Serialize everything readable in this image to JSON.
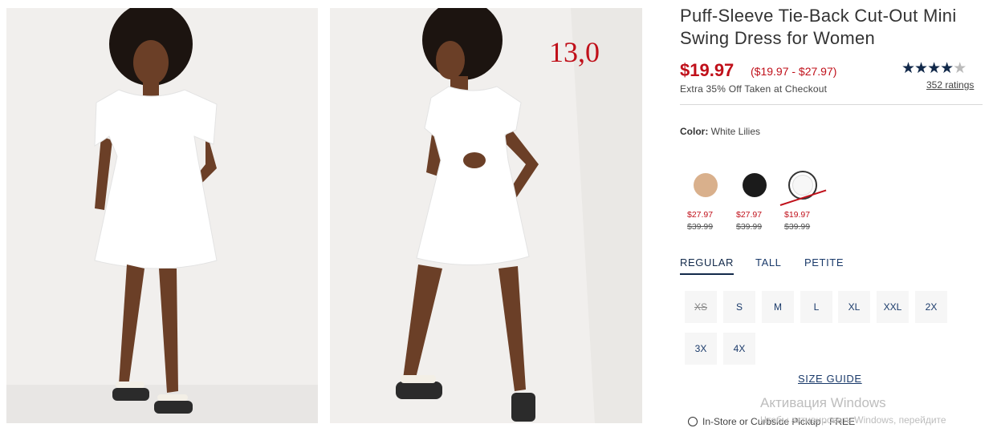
{
  "images": {
    "front_alt": "Model wearing white puff-sleeve mini dress, front view",
    "back_alt": "Model wearing white puff-sleeve mini dress, back view with tie-back cut-out",
    "overlay_number": "13,0"
  },
  "product": {
    "title": "Puff-Sleeve Tie-Back Cut-Out Mini Swing Dress for Women",
    "price": "$19.97",
    "price_range": "($19.97 - $27.97)",
    "promo": "Extra 35% Off Taken at Checkout",
    "rating_stars": 4.5,
    "ratings_link": "352 ratings",
    "color_label": "Color:",
    "color_value": "White Lilies"
  },
  "swatches": [
    {
      "name": "tan",
      "color": "#d9b08c",
      "price": "$27.97",
      "was": "$39.99"
    },
    {
      "name": "black",
      "color": "#1b1b1b",
      "price": "$27.97",
      "was": "$39.99"
    },
    {
      "name": "white",
      "color": "#f7f7f7",
      "price": "$19.97",
      "was": "$39.99",
      "selected": true
    }
  ],
  "fit_tabs": [
    "REGULAR",
    "TALL",
    "PETITE"
  ],
  "sizes": [
    {
      "label": "XS",
      "available": false
    },
    {
      "label": "S",
      "available": true
    },
    {
      "label": "M",
      "available": true
    },
    {
      "label": "L",
      "available": true
    },
    {
      "label": "XL",
      "available": true
    },
    {
      "label": "XXL",
      "available": true
    },
    {
      "label": "2X",
      "available": true
    },
    {
      "label": "3X",
      "available": true
    },
    {
      "label": "4X",
      "available": true
    }
  ],
  "size_guide": "SIZE GUIDE",
  "pickup": "In-Store or Curbside Pickup - FREE",
  "windows": {
    "activation": "Активация Windows",
    "activation_sub": "Чтобы активировать Windows, перейдите"
  },
  "colors": {
    "sale_red": "#c0101a",
    "navy": "#12294a"
  }
}
